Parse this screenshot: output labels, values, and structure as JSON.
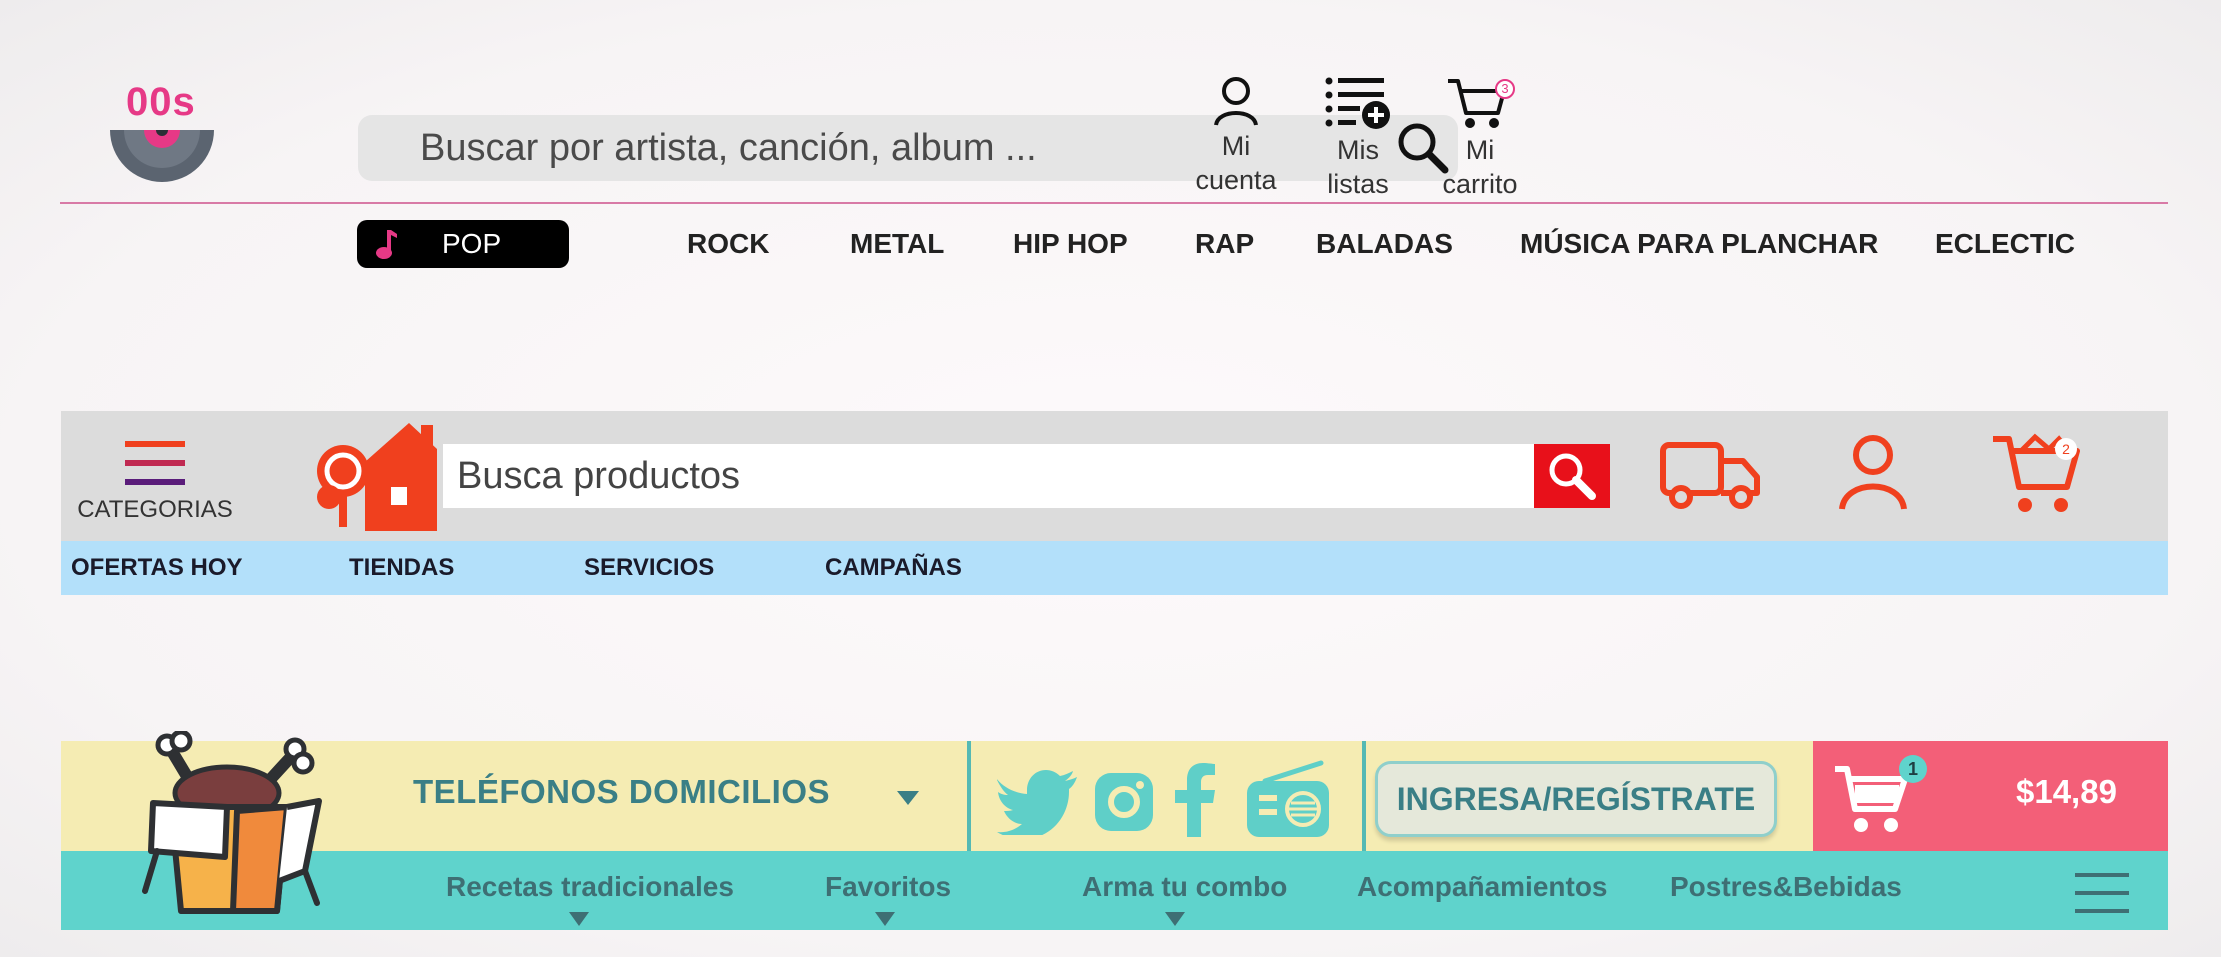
{
  "music_header": {
    "logo_text": "00s",
    "search_placeholder": "Buscar por artista, canción, album ...",
    "actions": [
      {
        "line1": "Mi",
        "line2": "cuenta",
        "icon": "user-icon"
      },
      {
        "line1": "Mis",
        "line2": "listas",
        "icon": "add-list-icon"
      },
      {
        "line1": "Mi",
        "line2": "carrito",
        "icon": "cart-icon",
        "badge": "3"
      }
    ],
    "genres": [
      "POP",
      "ROCK",
      "METAL",
      "HIP HOP",
      "RAP",
      "BALADAS",
      "MÚSICA PARA PLANCHAR",
      "ECLECTIC"
    ],
    "active_genre": "POP",
    "accent_color": "#e63986"
  },
  "shop_header": {
    "categories_label": "CATEGORIAS",
    "search_placeholder": "Busca productos",
    "cart_badge": "2",
    "nav": [
      "OFERTAS HOY",
      "TIENDAS",
      "SERVICIOS",
      "CAMPAÑAS"
    ],
    "accent_color": "#f0401e",
    "search_button_color": "#e8101a"
  },
  "food_header": {
    "phones_label": "TELÉFONOS DOMICILIOS",
    "social": [
      "twitter-icon",
      "instagram-icon",
      "facebook-icon",
      "radio-icon"
    ],
    "login_label": "INGRESA/REGÍSTRATE",
    "cart_badge": "1",
    "cart_total": "$14,89",
    "nav": [
      "Recetas tradicionales",
      "Favoritos",
      "Arma tu combo",
      "Acompañamientos",
      "Postres&Bebidas"
    ],
    "colors": {
      "yellow": "#f5ecb3",
      "teal": "#5fd3cc",
      "pink": "#f35f78",
      "text": "#3a7f86"
    }
  }
}
